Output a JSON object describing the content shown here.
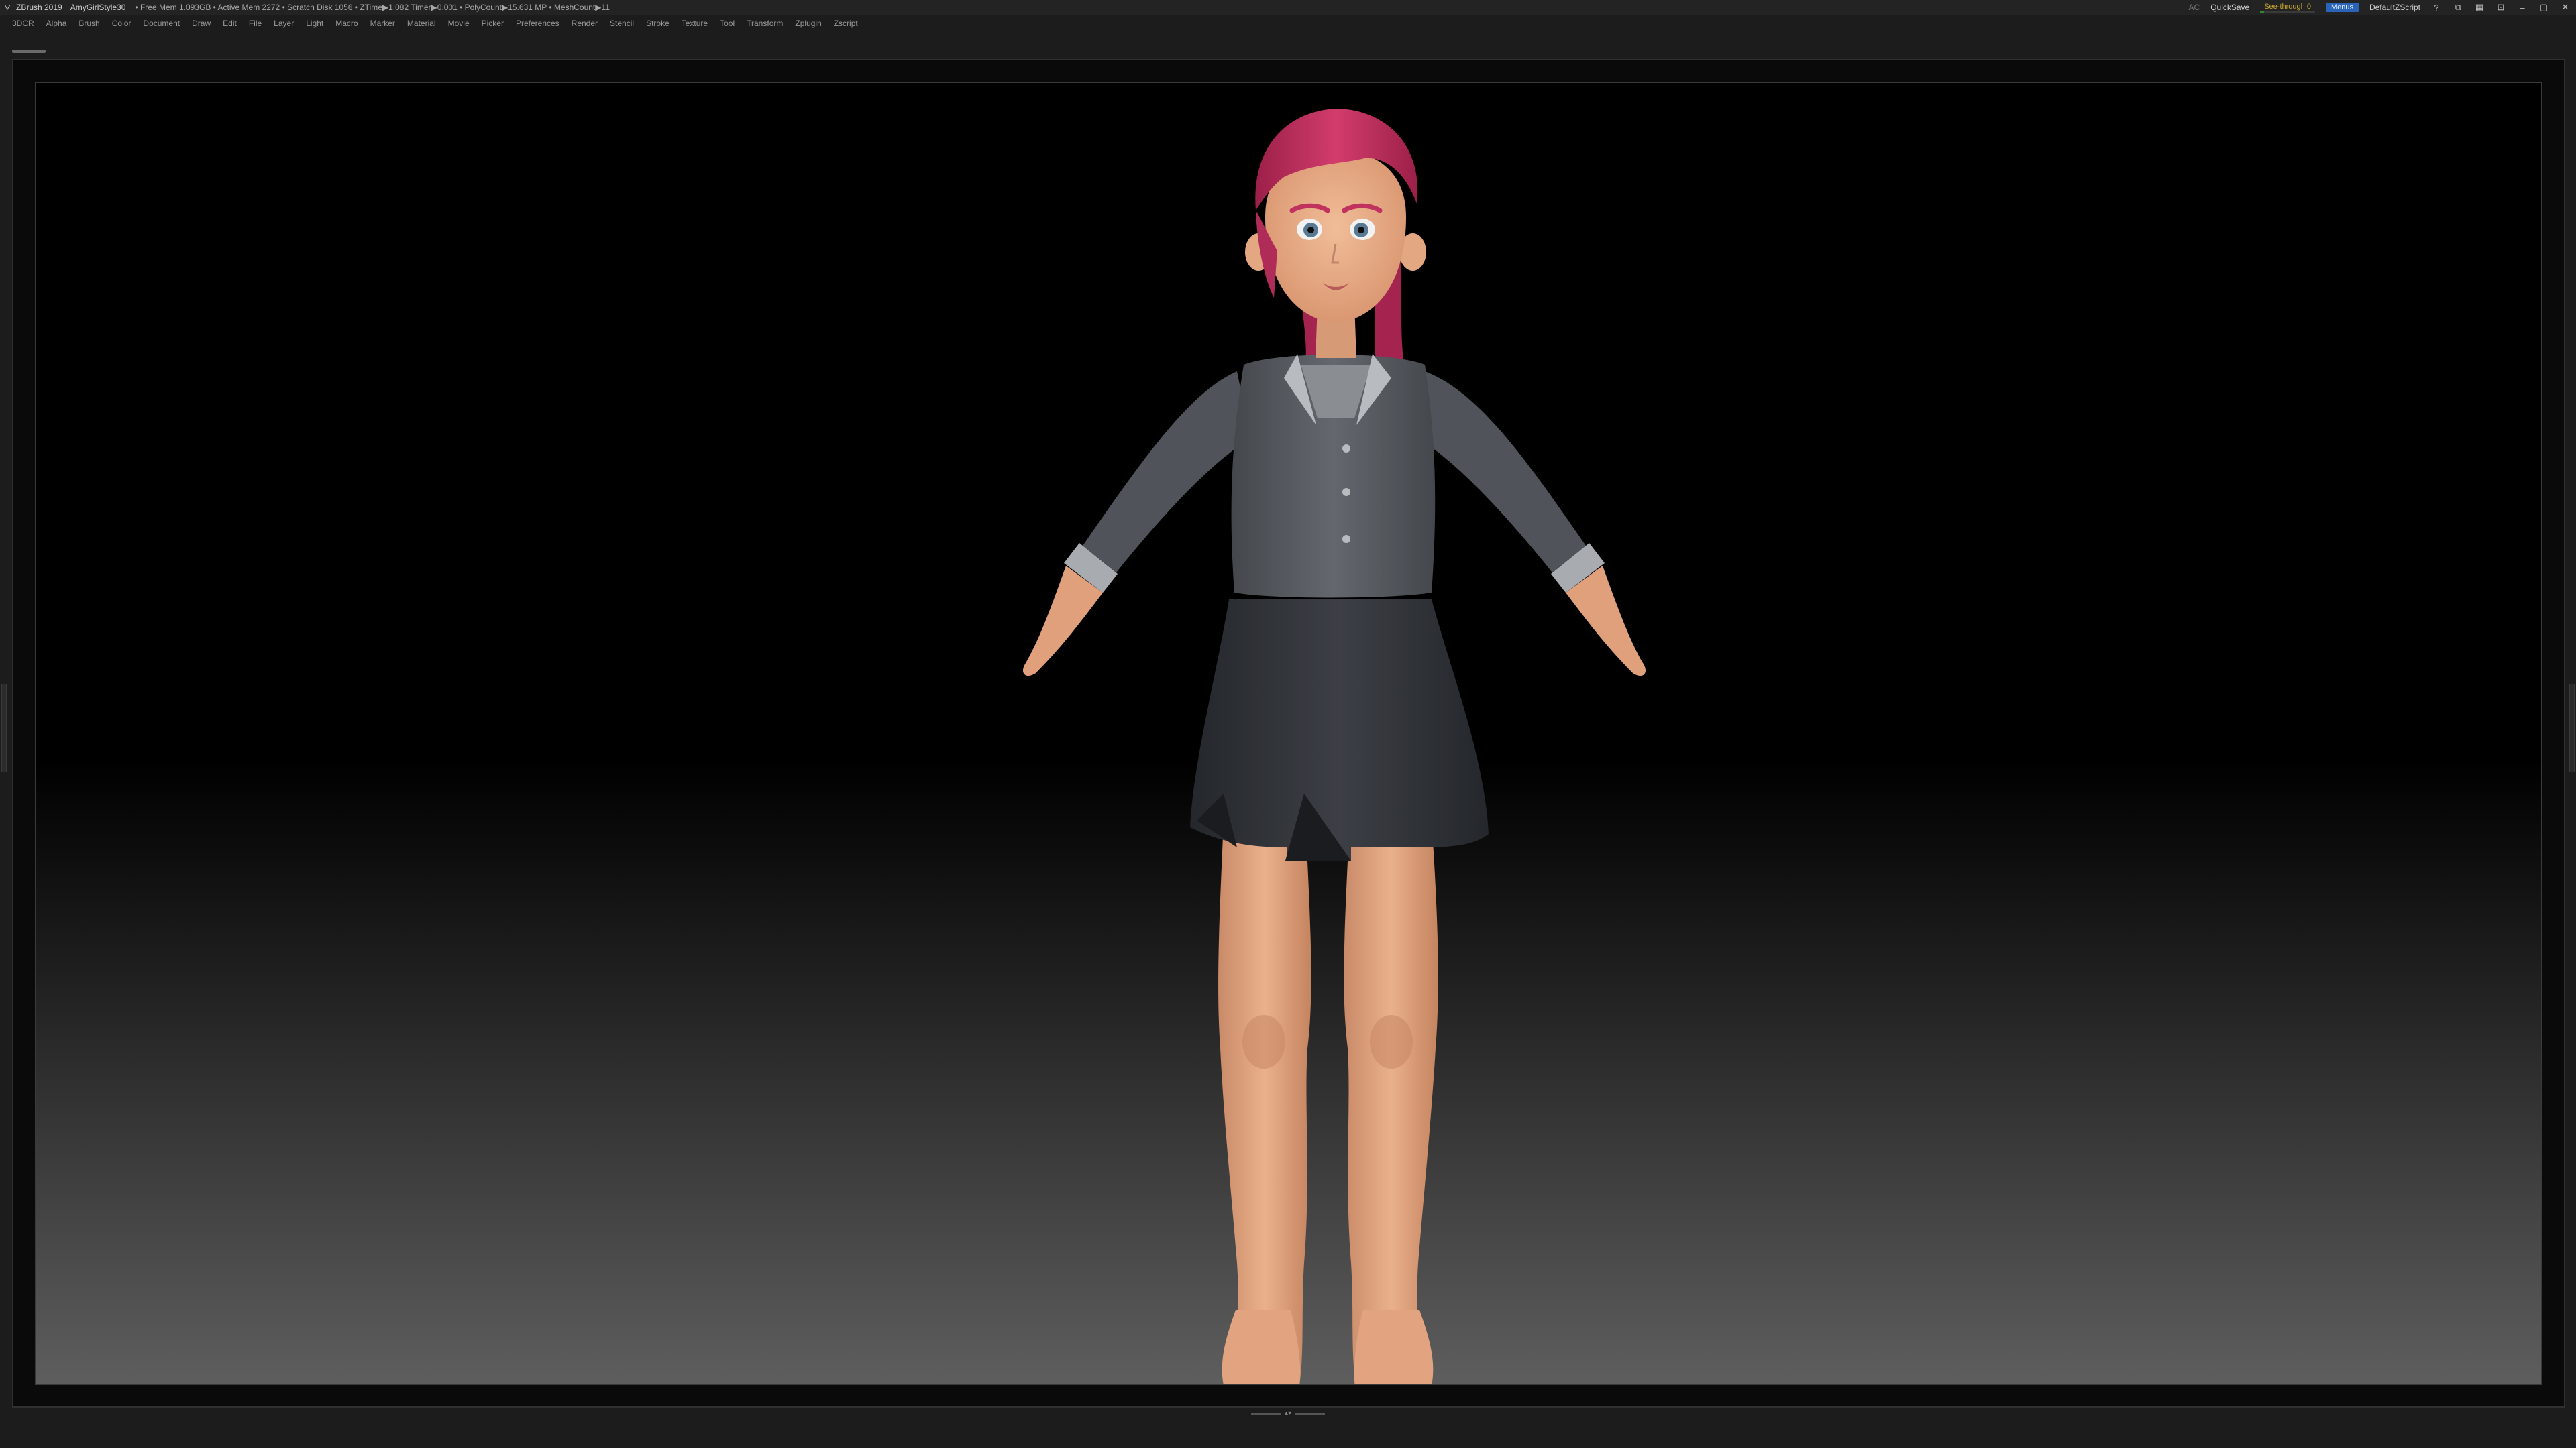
{
  "titlebar": {
    "app_name": "ZBrush 2019",
    "document": "AmyGirlStyle30",
    "stats": "• Free Mem 1.093GB • Active Mem 2272 • Scratch Disk 1056 • ZTime▶1.082 Timer▶0.001 • PolyCount▶15.631 MP • MeshCount▶11",
    "ac_label": "AC",
    "quicksave_label": "QuickSave",
    "see_through_label": "See-through 0",
    "see_through_value": 0,
    "menus_label": "Menus",
    "default_zscript_label": "DefaultZScript"
  },
  "menubar": {
    "items": [
      "3DCR",
      "Alpha",
      "Brush",
      "Color",
      "Document",
      "Draw",
      "Edit",
      "File",
      "Layer",
      "Light",
      "Macro",
      "Marker",
      "Material",
      "Movie",
      "Picker",
      "Preferences",
      "Render",
      "Stencil",
      "Stroke",
      "Texture",
      "Tool",
      "Transform",
      "Zplugin",
      "Zscript"
    ]
  },
  "colors": {
    "accent_blue": "#2a64b8",
    "see_through_green": "#2f8a2f",
    "see_through_text": "#c8a830",
    "hair": "#c2305e",
    "skin": "#e3a882",
    "jacket": "#565a60",
    "skirt": "#32353a"
  },
  "icons": [
    "zbrush-logo-icon",
    "help-icon",
    "layout-icon",
    "palette-icon",
    "minimize-icon",
    "maximize-icon",
    "close-icon"
  ]
}
